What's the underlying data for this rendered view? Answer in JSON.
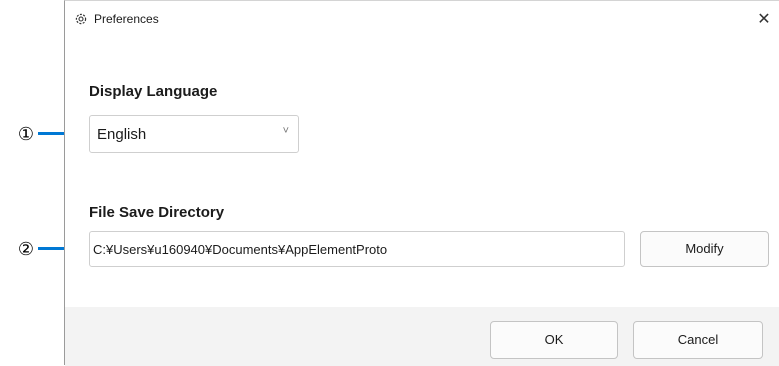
{
  "dialog": {
    "title": "Preferences",
    "close_symbol": "✕",
    "title_icon": "gear-icon",
    "close_icon": "close-icon"
  },
  "language": {
    "label": "Display Language",
    "selected": "English",
    "chevron_icon": "chevron-down-icon",
    "chevron_symbol": "˅"
  },
  "directory": {
    "label": "File Save Directory",
    "path": "C:¥Users¥u160940¥Documents¥AppElementProto",
    "modify_label": "Modify"
  },
  "footer": {
    "ok_label": "OK",
    "cancel_label": "Cancel"
  },
  "callouts": [
    {
      "symbol": "①"
    },
    {
      "symbol": "②"
    }
  ],
  "colors": {
    "leader_line": "#0078d4",
    "footer_background": "#f3f3f3"
  }
}
